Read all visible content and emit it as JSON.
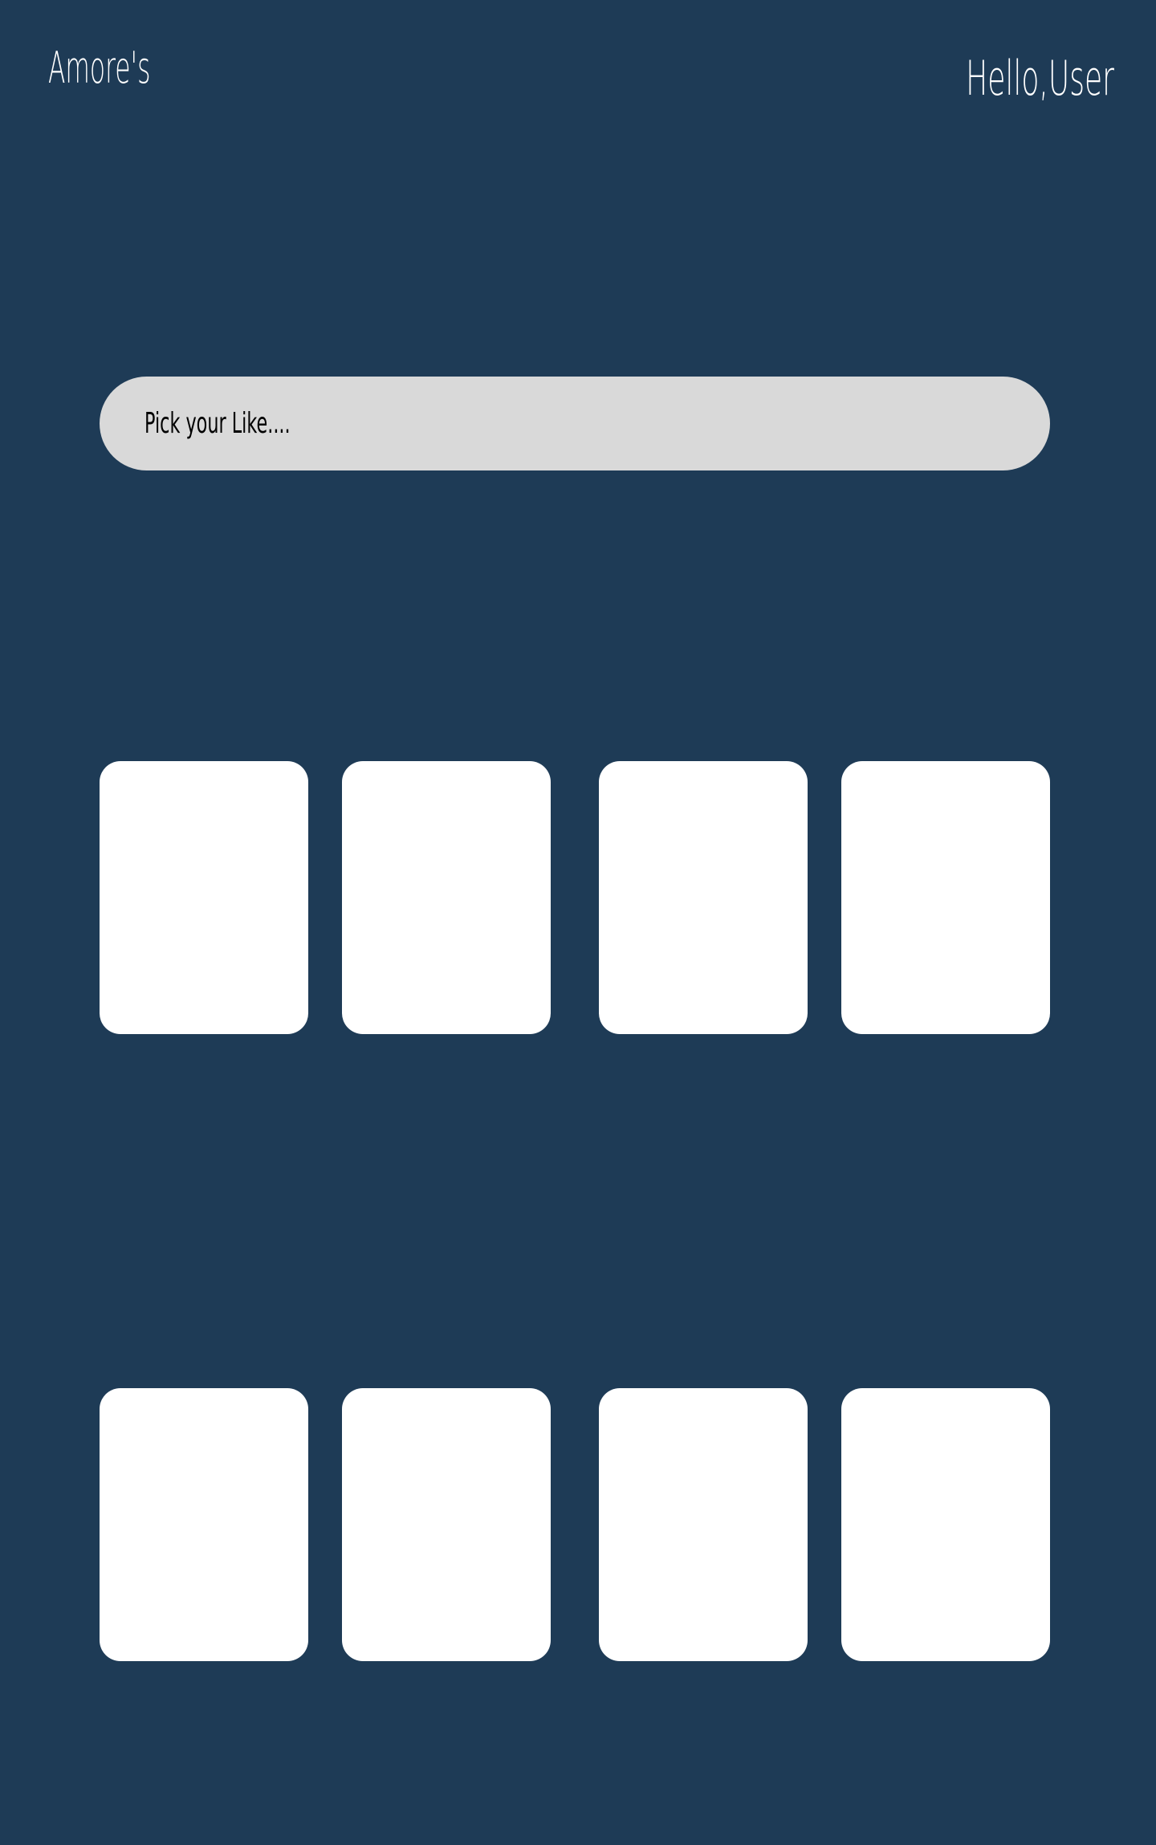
{
  "header": {
    "brand": "Amore's",
    "greeting": "Hello,User"
  },
  "search": {
    "placeholder": "Pick your Like....",
    "value": ""
  },
  "colors": {
    "background": "#1e3b56",
    "search_bar": "#d9d9d9",
    "card": "#ffffff",
    "header_text": "#ffffff"
  }
}
